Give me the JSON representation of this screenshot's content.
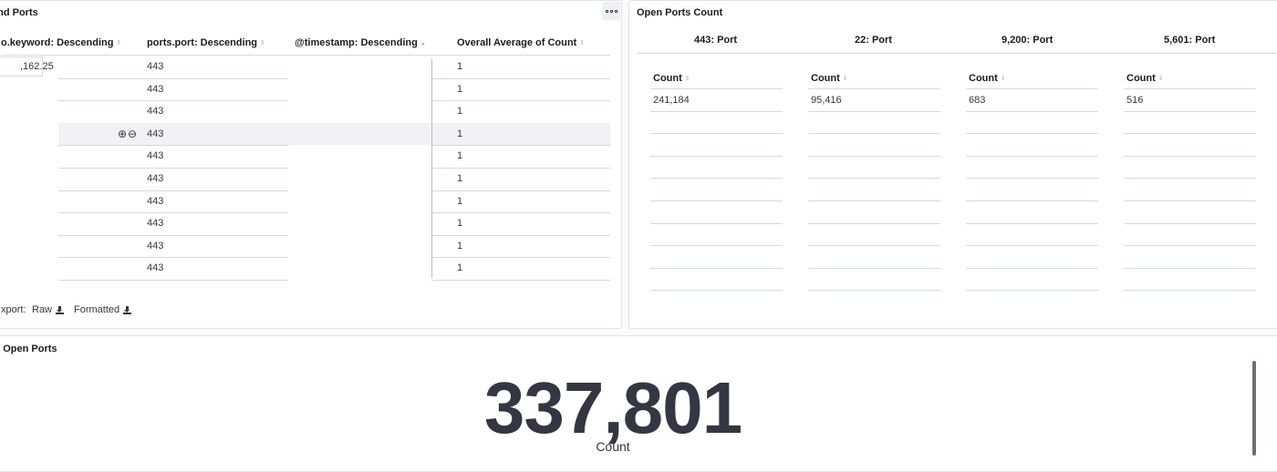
{
  "table_panel": {
    "title": "and Ports",
    "columns": [
      {
        "label": "o.keyword: Descending"
      },
      {
        "label": "ports.port: Descending"
      },
      {
        "label": "@timestamp: Descending"
      },
      {
        "label": "Overall Average of Count"
      }
    ],
    "first_cell": ",162.25",
    "rows": [
      {
        "port": "443",
        "avg": "1"
      },
      {
        "port": "443",
        "avg": "1"
      },
      {
        "port": "443",
        "avg": "1"
      },
      {
        "port": "443",
        "avg": "1"
      },
      {
        "port": "443",
        "avg": "1"
      },
      {
        "port": "443",
        "avg": "1"
      },
      {
        "port": "443",
        "avg": "1"
      },
      {
        "port": "443",
        "avg": "1"
      },
      {
        "port": "443",
        "avg": "1"
      },
      {
        "port": "443",
        "avg": "1"
      }
    ],
    "export_label": "xport:",
    "export_raw": "Raw",
    "export_formatted": "Formatted"
  },
  "ports_panel": {
    "title": "Open Ports Count",
    "ports": [
      {
        "header": "443: Port",
        "col_label": "Count",
        "value": "241,184"
      },
      {
        "header": "22: Port",
        "col_label": "Count",
        "value": "95,416"
      },
      {
        "header": "9,200: Port",
        "col_label": "Count",
        "value": "683"
      },
      {
        "header": "5,601: Port",
        "col_label": "Count",
        "value": "516"
      }
    ]
  },
  "metric_panel": {
    "title": "al Open Ports",
    "value": "337,801",
    "label": "Count"
  }
}
